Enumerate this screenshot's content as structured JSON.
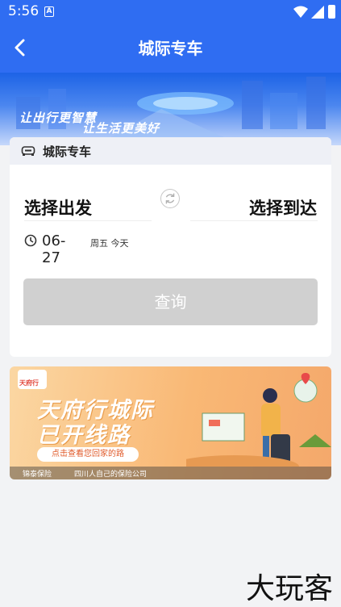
{
  "status_bar": {
    "time": "5:56",
    "notification_icon": "A"
  },
  "header": {
    "title": "城际专车"
  },
  "banner": {
    "slogan_line1": "让出行更智慧",
    "slogan_line2": "让生活更美好"
  },
  "tab": {
    "label": "城际专车"
  },
  "route": {
    "from_placeholder": "选择出发",
    "to_placeholder": "选择到达"
  },
  "date": {
    "value": "06-27",
    "weekday": "周五 今天"
  },
  "query_button": {
    "label": "查询"
  },
  "ad": {
    "logo_text": "天府行",
    "headline_line1": "天府行城际",
    "headline_line2": "已开线路",
    "cta": "点击查看您回家的路",
    "footer_left": "锦泰保险",
    "footer_right": "四川人自己的保险公司"
  },
  "watermark": "大玩客",
  "colors": {
    "primary": "#2f6df2",
    "disabled_button": "#d0d0d0",
    "background": "#f2f3f5"
  }
}
